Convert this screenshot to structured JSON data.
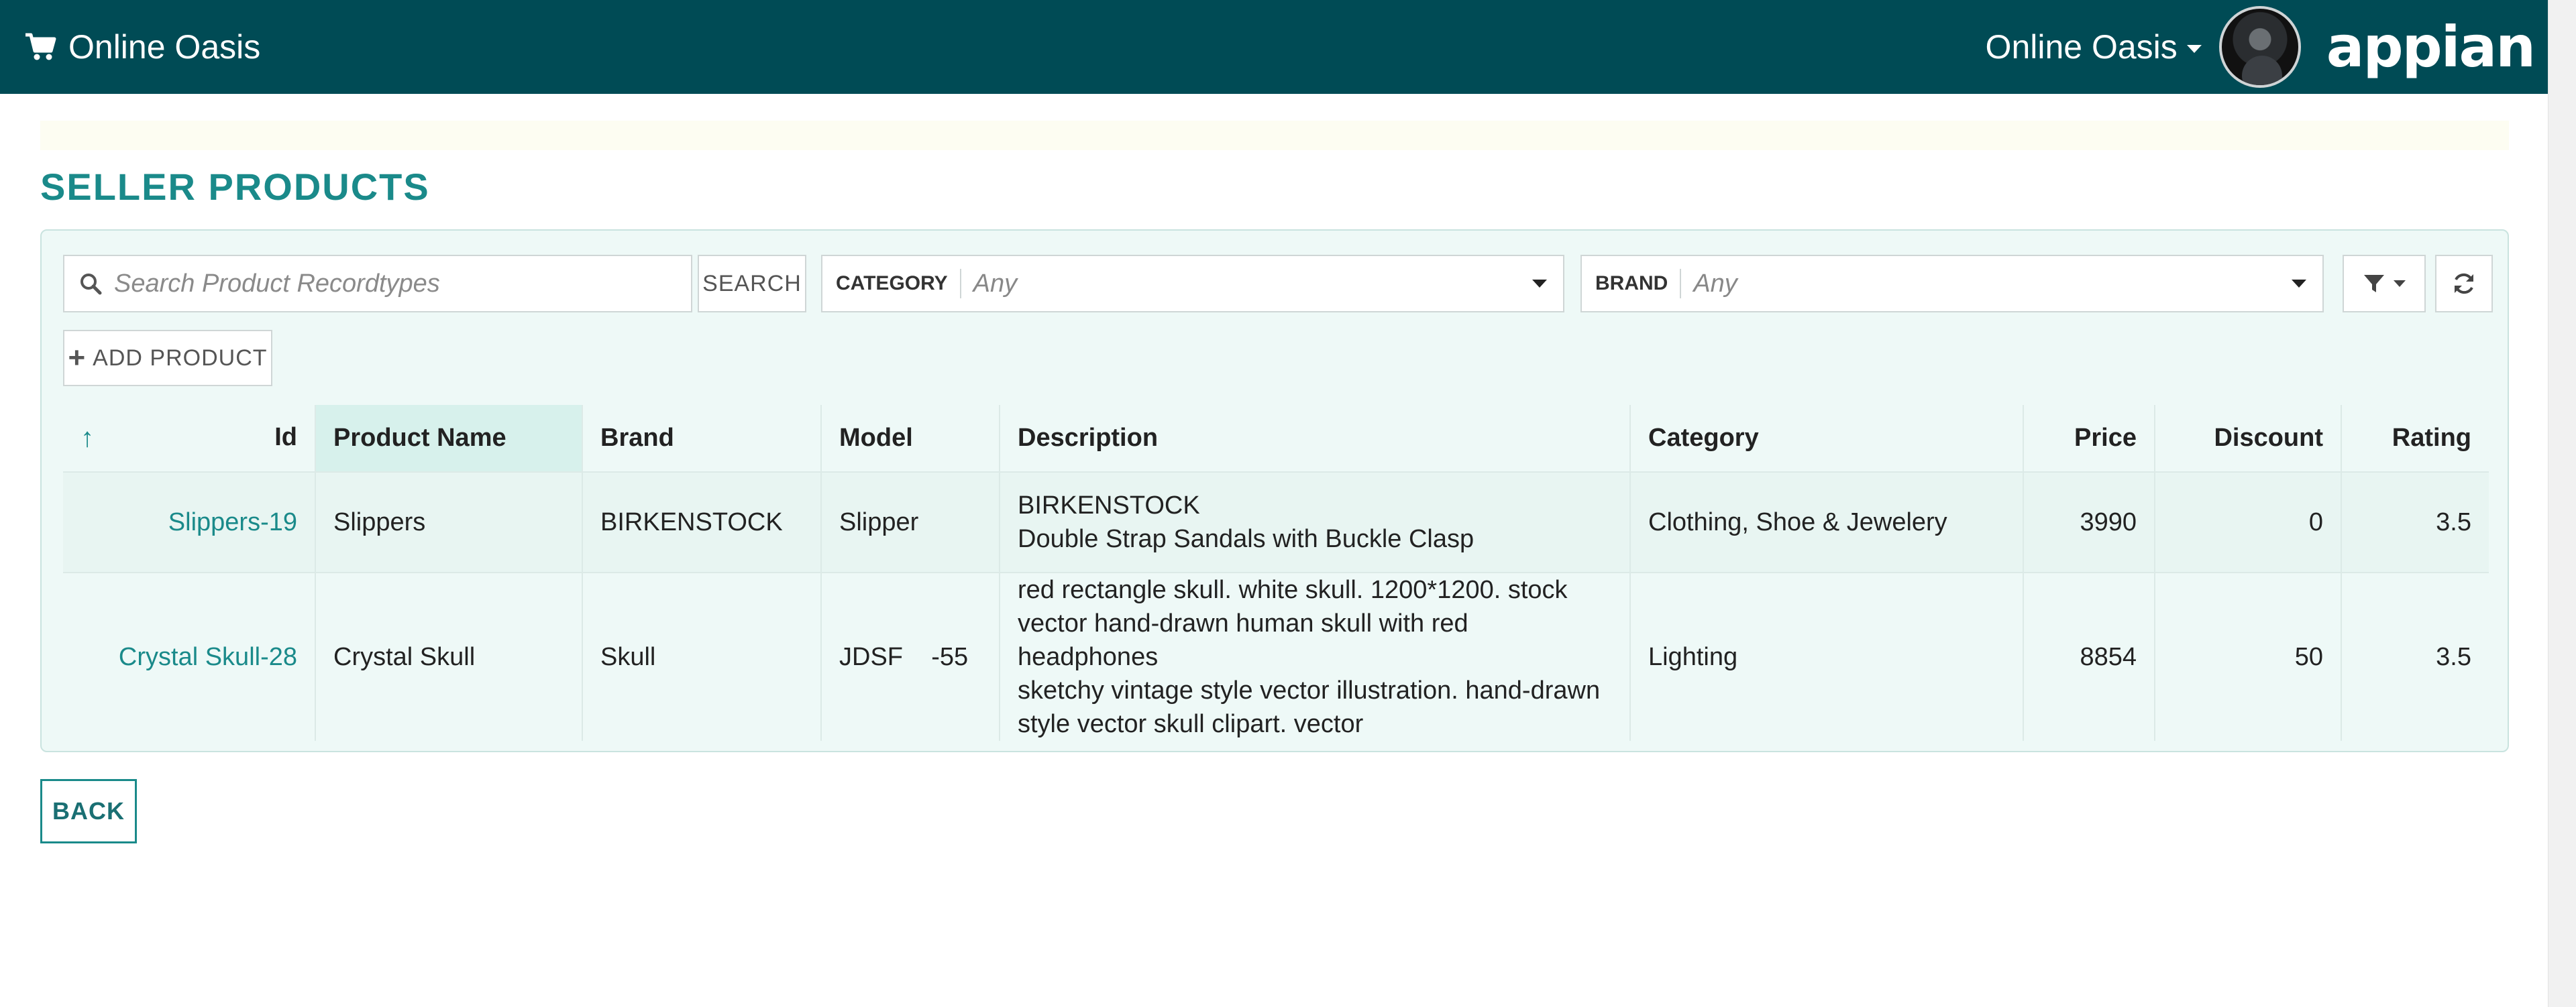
{
  "header": {
    "app_title": "Online Oasis",
    "site_menu_label": "Online Oasis",
    "logo_text": "appian",
    "icons": {
      "cart": "cart-icon",
      "caret": "caret-down-icon"
    }
  },
  "page": {
    "title": "SELLER PRODUCTS"
  },
  "controls": {
    "search_placeholder": "Search Product Recordtypes",
    "search_button": "SEARCH",
    "category_label": "CATEGORY",
    "category_value": "Any",
    "brand_label": "BRAND",
    "brand_value": "Any",
    "add_button": "ADD PRODUCT"
  },
  "table": {
    "columns": [
      "Id",
      "Product Name",
      "Brand",
      "Model",
      "Description",
      "Category",
      "Price",
      "Discount",
      "Rating"
    ],
    "rows": [
      {
        "id": "Slippers-19",
        "name": "Slippers",
        "brand": "BIRKENSTOCK",
        "model": "Slipper",
        "description": [
          "BIRKENSTOCK",
          "Double Strap Sandals with Buckle Clasp"
        ],
        "category": "Clothing, Shoe & Jewelery",
        "price": "3990",
        "discount": "0",
        "rating": "3.5"
      },
      {
        "id": "Crystal Skull-28",
        "name": "Crystal Skull",
        "brand": "Skull",
        "model": "JDSF    -55",
        "description": [
          "red rectangle skull. white skull. 1200*1200. stock",
          "vector hand-drawn human skull with red headphones",
          "sketchy vintage style vector illustration. hand-drawn",
          "style vector skull clipart. vector"
        ],
        "category": "Lighting",
        "price": "8854",
        "discount": "50",
        "rating": "3.5"
      }
    ]
  },
  "footer": {
    "back_button": "BACK"
  },
  "colors": {
    "header_bg": "#004b55",
    "accent": "#1a8a8a",
    "panel_bg": "#eef9f7"
  }
}
